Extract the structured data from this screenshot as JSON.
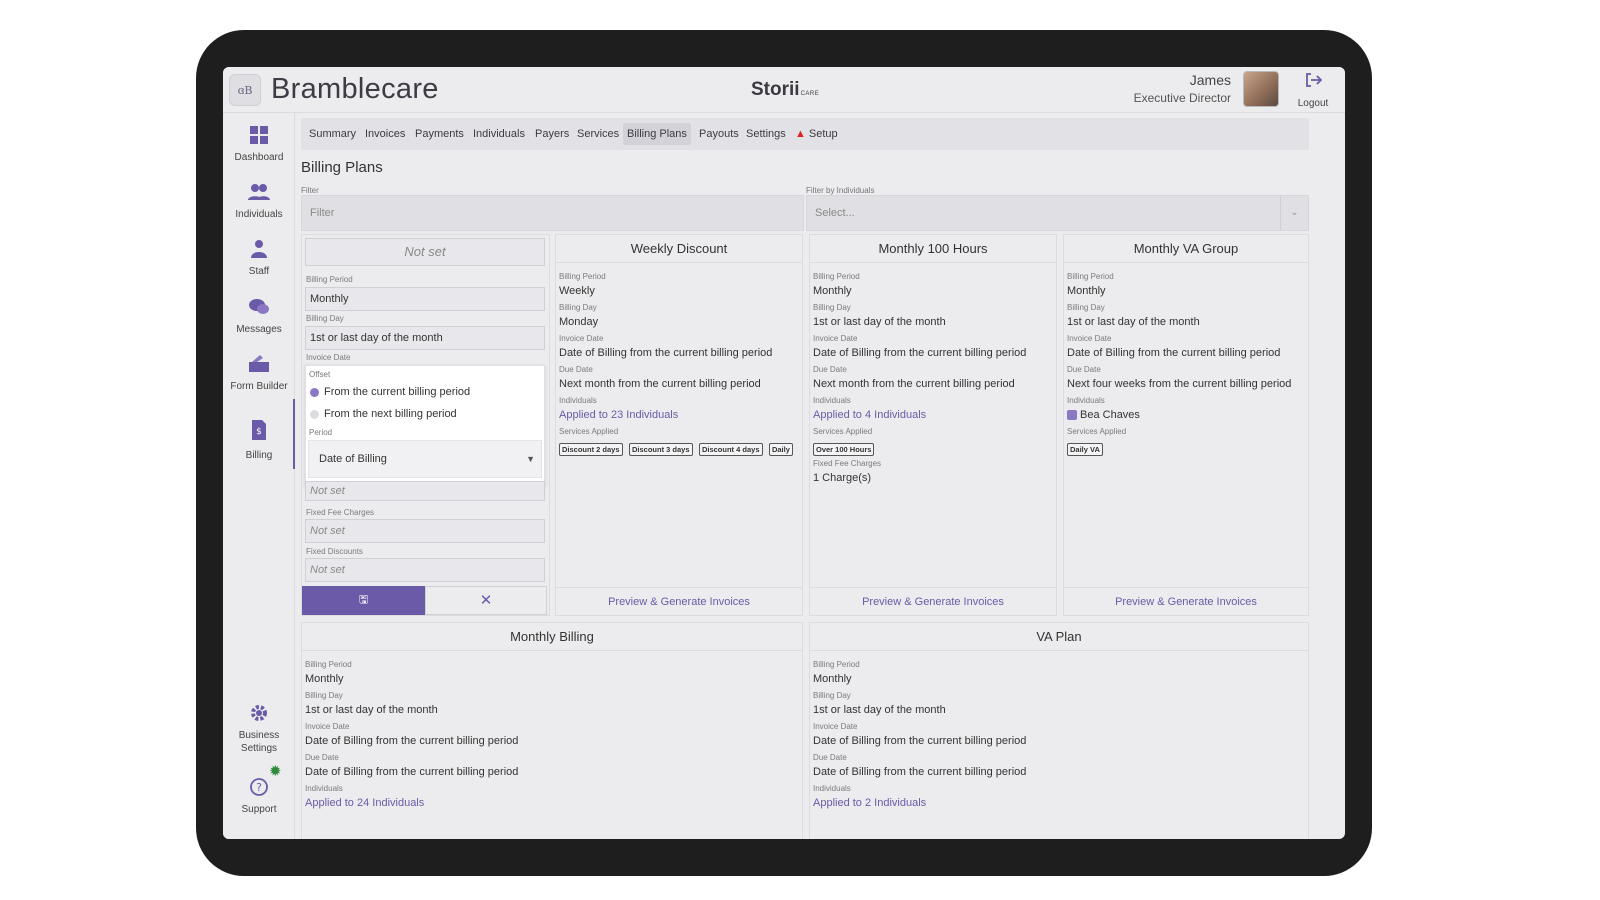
{
  "app": {
    "org_name": "Bramblecare",
    "logo_text": "ɞB",
    "brand": "Storii",
    "brand_sub": "CARE"
  },
  "user": {
    "name": "James",
    "role": "Executive Director",
    "logout_label": "Logout"
  },
  "sidebar": {
    "items": [
      {
        "label": "Dashboard",
        "icon": "dashboard-icon"
      },
      {
        "label": "Individuals",
        "icon": "individuals-icon"
      },
      {
        "label": "Staff",
        "icon": "staff-icon"
      },
      {
        "label": "Messages",
        "icon": "messages-icon"
      },
      {
        "label": "Form Builder",
        "icon": "form-builder-icon"
      },
      {
        "label": "Billing",
        "icon": "billing-icon"
      }
    ],
    "bottom": [
      {
        "label": "Business Settings",
        "icon": "gear-icon"
      },
      {
        "label": "Support",
        "icon": "help-icon"
      }
    ]
  },
  "tabs": [
    "Summary",
    "Invoices",
    "Payments",
    "Individuals",
    "Payers",
    "Services",
    "Billing Plans",
    "Payouts",
    "Settings",
    "Setup"
  ],
  "active_tab": "Billing Plans",
  "page": {
    "title": "Billing Plans",
    "filter_label": "Filter",
    "filter_placeholder": "Filter",
    "filter_by_label": "Filter by Individuals",
    "filter_by_placeholder": "Select..."
  },
  "edit_card": {
    "title_placeholder": "Not set",
    "billing_period_label": "Billing Period",
    "billing_period_value": "Monthly",
    "billing_day_label": "Billing Day",
    "billing_day_value": "1st or last day of the month",
    "invoice_date_label": "Invoice Date",
    "offset_label": "Offset",
    "offset_options": [
      "From the current billing period",
      "From the next billing period"
    ],
    "period_label": "Period",
    "period_value": "Date of Billing",
    "below_popup_placeholder": "Not set",
    "fixed_fee_label": "Fixed Fee Charges",
    "fixed_fee_placeholder": "Not set",
    "fixed_discounts_label": "Fixed Discounts",
    "fixed_discounts_placeholder": "Not set"
  },
  "labels": {
    "billing_period": "Billing Period",
    "billing_day": "Billing Day",
    "invoice_date": "Invoice Date",
    "due_date": "Due Date",
    "individuals": "Individuals",
    "services_applied": "Services Applied",
    "fixed_fee_charges": "Fixed Fee Charges",
    "preview": "Preview & Generate Invoices"
  },
  "plans": {
    "weekly_discount": {
      "title": "Weekly Discount",
      "billing_period": "Weekly",
      "billing_day": "Monday",
      "invoice_date": "Date of Billing from the current billing period",
      "due_date": "Next month from the current billing period",
      "individuals": "Applied to 23 Individuals",
      "services": [
        "Discount 2 days",
        "Discount 3 days",
        "Discount 4 days",
        "Daily"
      ]
    },
    "monthly_100": {
      "title": "Monthly 100 Hours",
      "billing_period": "Monthly",
      "billing_day": "1st or last day of the month",
      "invoice_date": "Date of Billing from the current billing period",
      "due_date": "Next month from the current billing period",
      "individuals": "Applied to 4 Individuals",
      "services": [
        "Over 100 Hours"
      ],
      "fixed_fee": "1 Charge(s)"
    },
    "monthly_va": {
      "title": "Monthly VA Group",
      "billing_period": "Monthly",
      "billing_day": "1st or last day of the month",
      "invoice_date": "Date of Billing from the current billing period",
      "due_date": "Next four weeks from the current billing period",
      "individual": "Bea Chaves",
      "services": [
        "Daily VA"
      ]
    },
    "monthly_billing": {
      "title": "Monthly Billing",
      "billing_period": "Monthly",
      "billing_day": "1st or last day of the month",
      "invoice_date": "Date of Billing from the current billing period",
      "due_date": "Date of Billing from the current billing period",
      "individuals": "Applied to 24 Individuals"
    },
    "va_plan": {
      "title": "VA Plan",
      "billing_period": "Monthly",
      "billing_day": "1st or last day of the month",
      "invoice_date": "Date of Billing from the current billing period",
      "due_date": "Date of Billing from the current billing period",
      "individuals": "Applied to 2 Individuals"
    }
  },
  "colors": {
    "accent": "#6b5aa8",
    "warning": "#d22222",
    "badge_green": "#2d8a3a"
  }
}
